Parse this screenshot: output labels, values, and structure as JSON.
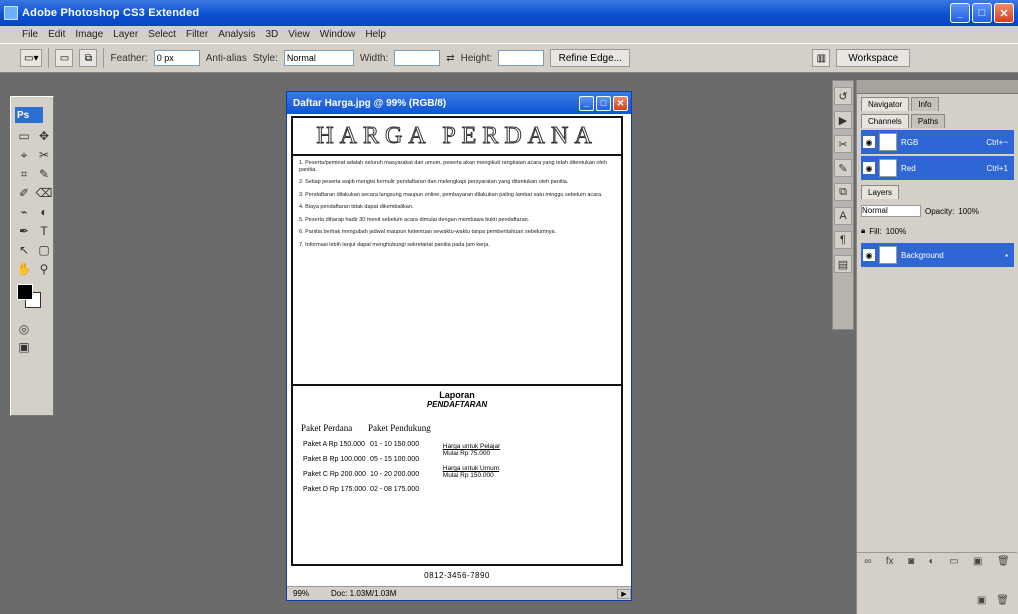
{
  "window": {
    "title": "Adobe Photoshop CS3 Extended",
    "minimize": "_",
    "maximize": "□",
    "close": "✕"
  },
  "menu": [
    "File",
    "Edit",
    "Image",
    "Layer",
    "Select",
    "Filter",
    "Analysis",
    "3D",
    "View",
    "Window",
    "Help"
  ],
  "options": {
    "feather_label": "Feather:",
    "feather_value": "0 px",
    "antialias_label": "Anti-alias",
    "style_label": "Style:",
    "style_value": "Normal",
    "width_label": "Width:",
    "height_label": "Height:",
    "refine_label": "Refine Edge...",
    "workspace_label": "Workspace"
  },
  "tools": {
    "logo": "Ps",
    "items": [
      "▭",
      "✥",
      "⌖",
      "✂",
      "⌗",
      "✎",
      "✐",
      "⌫",
      "⌁",
      "◐",
      "✒",
      "T",
      "↖",
      "▢",
      "✋",
      "⚲"
    ]
  },
  "document": {
    "title": "Daftar Harga.jpg @ 99% (RGB/8)",
    "header": "HARGA PERDANA",
    "rules": [
      "1. Peserta/peminat adalah seluruh masyarakat dan umum, peserta akan mengikuti rangkaian acara yang telah ditentukan oleh panitia.",
      "2. Setiap peserta wajib mengisi formulir pendaftaran dan melengkapi persyaratan yang ditentukan oleh panitia.",
      "3. Pendaftaran dilakukan secara langsung maupun online, pembayaran dilakukan paling lambat satu minggu sebelum acara.",
      "4. Biaya pendaftaran tidak dapat dikembalikan.",
      "5. Peserta diharap hadir 30 menit sebelum acara dimulai dengan membawa bukti pendaftaran.",
      "6. Panitia berhak mengubah jadwal maupun ketentuan sewaktu-waktu tanpa pemberitahuan sebelumnya.",
      "7. Informasi lebih lanjut dapat menghubungi sekretariat panitia pada jam kerja."
    ],
    "section_title": "Laporan",
    "section_sub": "PENDAFTARAN",
    "table_headers": [
      "Paket Perdana",
      "Paket Pendukung"
    ],
    "rows": [
      [
        "Paket A  Rp 150.000",
        "01 - 10     150.000"
      ],
      [
        "Paket B  Rp 100.000",
        "05 - 15     100.000"
      ],
      [
        "Paket C  Rp 200.000",
        "10 - 20     200.000"
      ],
      [
        "Paket D  Rp 175.000",
        "02 - 08     175.000"
      ]
    ],
    "side": [
      "Harga untuk Pelajar",
      "Mulai  Rp 75.000",
      "Harga untuk Umum",
      "Mulai  Rp 150.000"
    ],
    "contact": "0812-3456-7890",
    "zoom": "99%",
    "status": "Doc: 1.03M/1.03M"
  },
  "panels": {
    "tabs_top": [
      "Navigator",
      "Info"
    ],
    "tabs_mid": [
      "Channels",
      "Paths"
    ],
    "channels": [
      {
        "name": "RGB",
        "opacity": "Ctrl+~"
      },
      {
        "name": "Red",
        "opacity": "Ctrl+1"
      }
    ],
    "layers_tab": "Layers",
    "blend": "Normal",
    "opacity_label": "Opacity:",
    "opacity_value": "100%",
    "fill_label": "Fill:",
    "fill_value": "100%",
    "layer_name": "Background"
  }
}
